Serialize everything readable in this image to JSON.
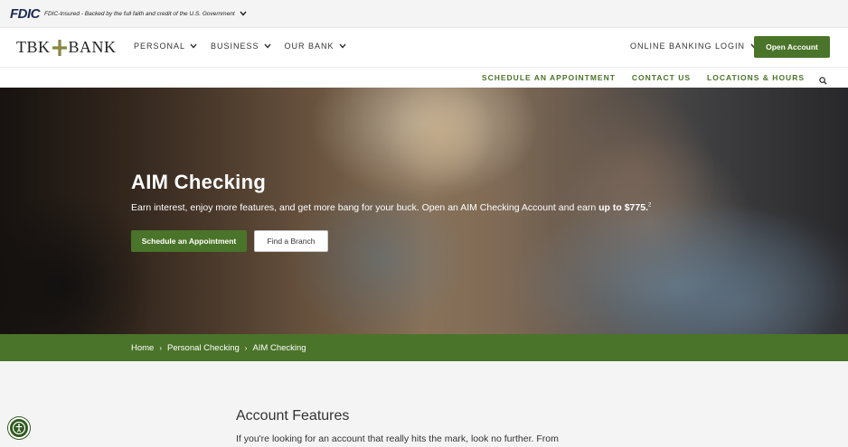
{
  "fdic": {
    "logo": "FDIC",
    "text": "FDIC-Insured - Backed by the full faith and credit of the U.S. Government"
  },
  "header": {
    "logo_left": "TBK",
    "logo_right": "BANK",
    "nav": [
      {
        "label": "PERSONAL"
      },
      {
        "label": "BUSINESS"
      },
      {
        "label": "OUR BANK"
      }
    ],
    "online_banking": "ONLINE BANKING LOGIN",
    "open_account": "Open Account"
  },
  "utility": {
    "links": [
      "SCHEDULE AN APPOINTMENT",
      "CONTACT US",
      "LOCATIONS & HOURS"
    ]
  },
  "hero": {
    "title": "AIM Checking",
    "subtitle_prefix": "Earn interest, enjoy more features, and get more bang for your buck. Open an AIM Checking Account and earn ",
    "subtitle_bold": "up to $775.",
    "subtitle_sup": "2",
    "primary_button": "Schedule an Appointment",
    "secondary_button": "Find a Branch"
  },
  "breadcrumb": [
    "Home",
    "Personal Checking",
    "AIM Checking"
  ],
  "content": {
    "heading": "Account Features",
    "paragraph": "If you're looking for an account that really hits the mark, look no further. From"
  },
  "colors": {
    "brand_green": "#4a7429",
    "fdic_navy": "#1d2b55"
  }
}
